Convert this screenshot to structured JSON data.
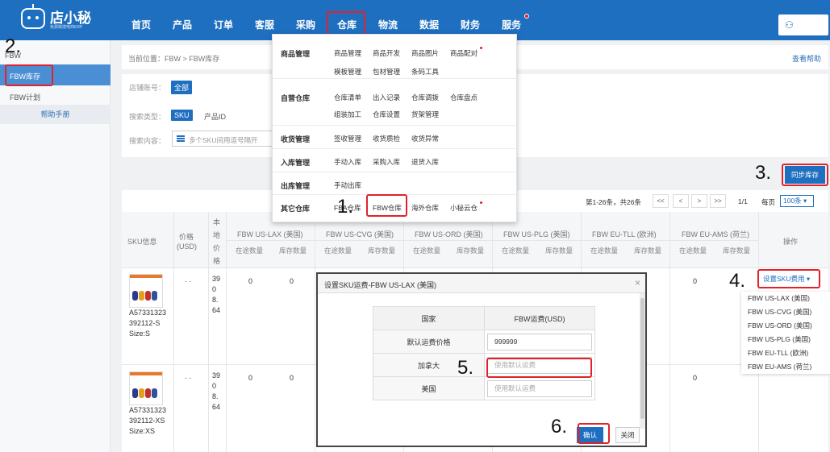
{
  "logo": {
    "name": "店小秘",
    "sub": "免费跨境电商ERP"
  },
  "nav": [
    {
      "label": "首页"
    },
    {
      "label": "产品"
    },
    {
      "label": "订单"
    },
    {
      "label": "客服"
    },
    {
      "label": "采购"
    },
    {
      "label": "仓库"
    },
    {
      "label": "物流"
    },
    {
      "label": "数据"
    },
    {
      "label": "财务"
    },
    {
      "label": "服务"
    }
  ],
  "sidebar": {
    "title": "FBW",
    "items": [
      {
        "label": "FBW库存"
      },
      {
        "label": "FBW计划"
      }
    ],
    "help": "帮助手册"
  },
  "breadcrumb": "当前位置：FBW > FBW库存",
  "help_link": "查看帮助",
  "filters": {
    "shop_label": "店铺账号：",
    "shop_value": "全部",
    "type_label": "搜索类型：",
    "type_sku": "SKU",
    "type_pid": "产品ID",
    "content_label": "搜索内容：",
    "content_placeholder": "多个SKU间用逗号隔开"
  },
  "sync_button": "同步库存",
  "pager": {
    "summary": "第1-26条，共26条",
    "buttons": [
      "<<",
      "<",
      ">",
      ">>"
    ],
    "page": "1/1",
    "perpage_label": "每页",
    "perpage_value": "100条"
  },
  "table": {
    "headers": {
      "sku": "SKU信息",
      "price": "价格",
      "price_unit": "(USD)",
      "local_price": [
        "本",
        "地",
        "价",
        "格"
      ],
      "ops": "操作"
    },
    "warehouses": [
      "FBW US-LAX (美国)",
      "FBW US-CVG (美国)",
      "FBW US-ORD (美国)",
      "FBW US-PLG (美国)",
      "FBW EU-TLL (欧洲)",
      "FBW EU-AMS (荷兰)"
    ],
    "sub_cols": [
      "在途数量",
      "库存数量"
    ],
    "rows": [
      {
        "sku": [
          "A57331323",
          "392112-S",
          "Size:S"
        ],
        "price": "- -",
        "local_price": [
          "39",
          "0",
          "8.",
          "64"
        ],
        "lax_transit": "0",
        "lax_stock": "0",
        "ams_transit": "0"
      },
      {
        "sku": [
          "A57331323",
          "392112-XS",
          "Size:XS"
        ],
        "price": "- -",
        "local_price": [
          "39",
          "0",
          "8.",
          "64"
        ],
        "lax_transit": "0",
        "lax_stock": "0",
        "ams_transit": "0"
      }
    ]
  },
  "dropdown": {
    "sections": [
      {
        "cat": "商品管理",
        "links": [
          "商品管理",
          "商品开发",
          "商品图片",
          "商品配对",
          "模板管理",
          "包材管理",
          "条码工具"
        ]
      },
      {
        "cat": "自营仓库",
        "links": [
          "仓库清单",
          "出入记录",
          "仓库调拨",
          "仓库盘点",
          "组装加工",
          "仓库设置",
          "货架管理"
        ]
      },
      {
        "cat": "收货管理",
        "links": [
          "签收管理",
          "收货质检",
          "收货异常"
        ]
      },
      {
        "cat": "入库管理",
        "links": [
          "手动入库",
          "采购入库",
          "退货入库"
        ]
      },
      {
        "cat": "出库管理",
        "links": [
          "手动出库"
        ]
      },
      {
        "cat": "其它仓库",
        "links": [
          "FBA仓库",
          "FBW仓库",
          "海外仓库",
          "小秘云仓"
        ]
      }
    ]
  },
  "ship_fee": {
    "button": "设置SKU费用",
    "options": [
      "FBW US-LAX (美国)",
      "FBW US-CVG (美国)",
      "FBW US-ORD (美国)",
      "FBW US-PLG (美国)",
      "FBW EU-TLL (欧洲)",
      "FBW EU-AMS (荷兰)"
    ]
  },
  "modal": {
    "title": "设置SKU运费-FBW US-LAX (美国)",
    "col_country": "国家",
    "col_fee": "FBW运费(USD)",
    "rows": [
      {
        "label": "默认运费价格",
        "value": "999999"
      },
      {
        "label": "加拿大",
        "placeholder": "使用默认运费"
      },
      {
        "label": "美国",
        "placeholder": "使用默认运费"
      }
    ],
    "ok": "确认",
    "close": "关闭"
  },
  "steps": [
    "1.",
    "2.",
    "3.",
    "4.",
    "5.",
    "6."
  ],
  "colors": {
    "brand": "#1e6fc0",
    "highlight": "#e0232b"
  }
}
